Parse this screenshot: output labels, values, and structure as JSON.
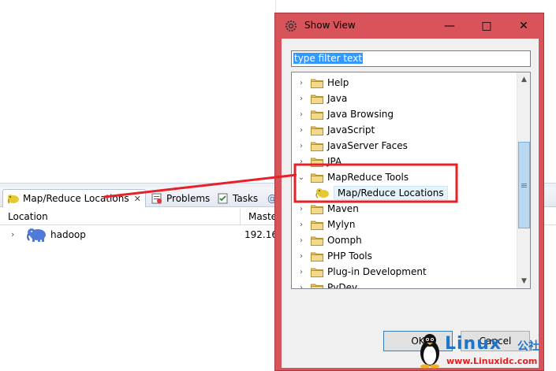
{
  "views_panel": {
    "tabs": [
      {
        "label": "Map/Reduce Locations",
        "active": true,
        "icon": "elephant-icon"
      },
      {
        "label": "Problems",
        "icon": "problems-icon"
      },
      {
        "label": "Tasks",
        "icon": "tasks-icon"
      },
      {
        "label": "@",
        "icon": "javadoc-icon"
      }
    ],
    "close_glyph": "✕",
    "columns": [
      "Location",
      "Maste"
    ],
    "rows": [
      {
        "location": "hadoop",
        "master": "192.16"
      }
    ]
  },
  "dialog": {
    "title": "Show View",
    "filter_placeholder": "type filter text",
    "tree": [
      {
        "label": "Help",
        "expanded": false
      },
      {
        "label": "Java",
        "expanded": false
      },
      {
        "label": "Java Browsing",
        "expanded": false
      },
      {
        "label": "JavaScript",
        "expanded": false
      },
      {
        "label": "JavaServer Faces",
        "expanded": false
      },
      {
        "label": "JPA",
        "expanded": false
      },
      {
        "label": "MapReduce Tools",
        "expanded": true
      },
      {
        "label": "Map/Reduce Locations",
        "child": true
      },
      {
        "label": "Maven",
        "expanded": false
      },
      {
        "label": "Mylyn",
        "expanded": false
      },
      {
        "label": "Oomph",
        "expanded": false
      },
      {
        "label": "PHP Tools",
        "expanded": false
      },
      {
        "label": "Plug-in Development",
        "expanded": false
      },
      {
        "label": "PyDev",
        "expanded": false
      }
    ],
    "buttons": {
      "ok": "OK",
      "cancel": "Cancel"
    },
    "window_controls": {
      "minimize": "—",
      "maximize": "□",
      "close": "✕"
    }
  },
  "watermark": {
    "brand": "Linux",
    "brand_cn": "公社",
    "url": "www.Linuxidc.com"
  },
  "colors": {
    "annotation_red": "#e8202a",
    "dialog_frame": "#d8545a",
    "selection": "#3399ff",
    "folder": "#e8c46a"
  }
}
